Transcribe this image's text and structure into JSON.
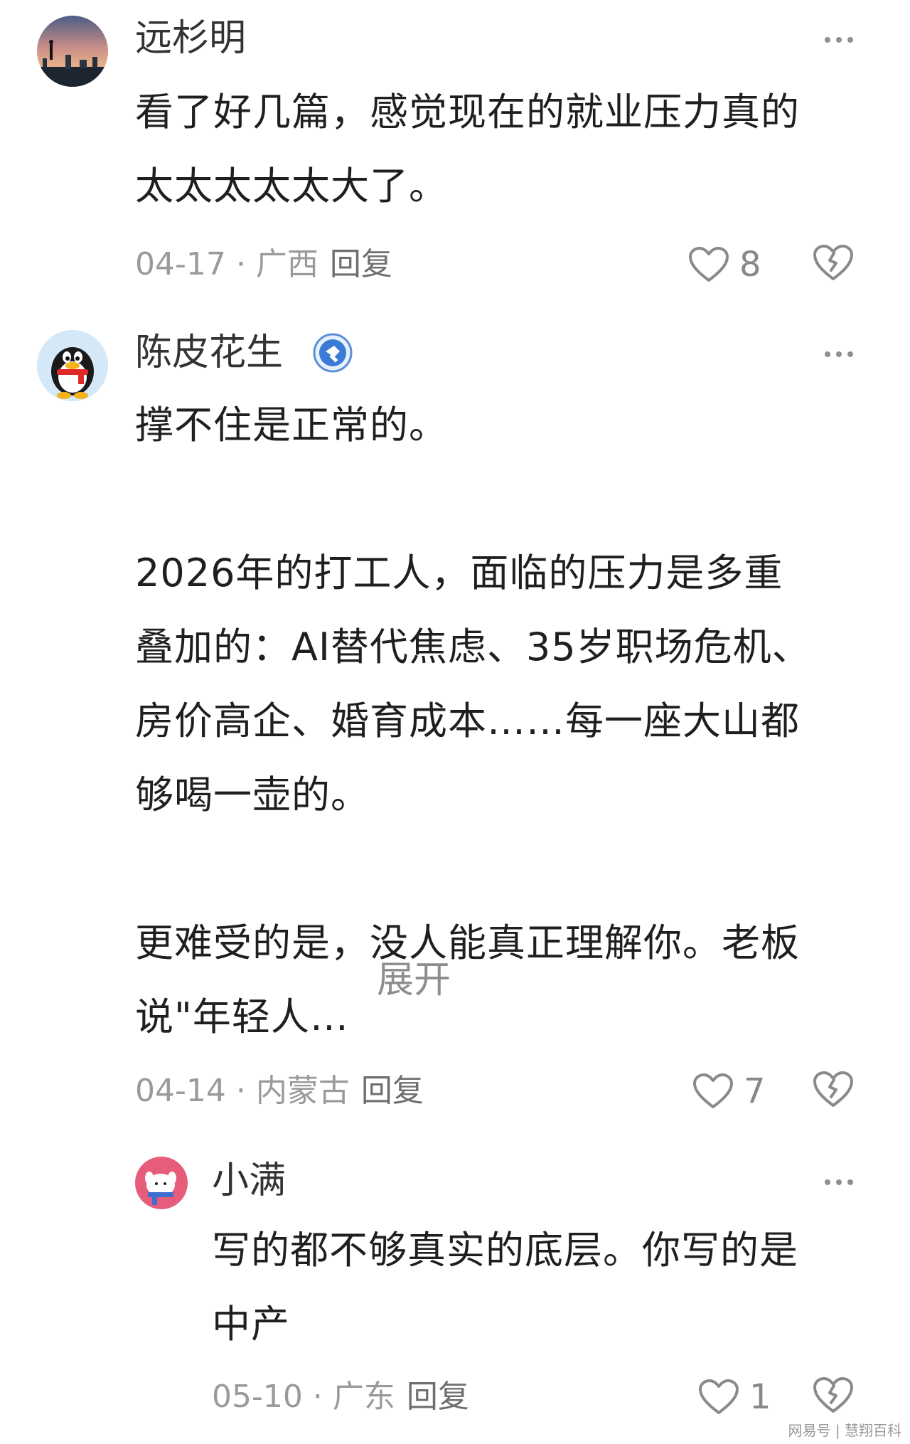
{
  "comments": [
    {
      "username": "远杉明",
      "body": "看了好几篇，感觉现在的就业压力真的\n太太太太太大了。",
      "date": "04-17",
      "location": "广西",
      "reply_label": "回复",
      "likes": "8"
    },
    {
      "username": "陈皮花生",
      "body": "撑不住是正常的。\n\n2026年的打工人，面临的压力是多重\n叠加的：AI替代焦虑、35岁职场危机、\n房价高企、婚育成本……每一座大山都\n够喝一壶的。\n\n更难受的是，没人能真正理解你。老板\n说\"年轻人…",
      "expand_label": "展开",
      "date": "04-14",
      "location": "内蒙古",
      "reply_label": "回复",
      "likes": "7"
    },
    {
      "username": "小满",
      "body": "写的都不够真实的底层。你写的是\n中产",
      "date": "05-10",
      "location": "广东",
      "reply_label": "回复",
      "likes": "1"
    }
  ],
  "watermark": "网易号 | 慧翔百科",
  "icons": {
    "more": "more-dots-icon",
    "like": "heart-outline-icon",
    "dislike": "broken-heart-icon",
    "verified": "verified-badge-icon"
  },
  "colors": {
    "text_primary": "#1f1f1f",
    "text_secondary": "#9a9a9a",
    "icon_gray": "#8f8f8f",
    "badge_blue": "#3a7bd5"
  }
}
